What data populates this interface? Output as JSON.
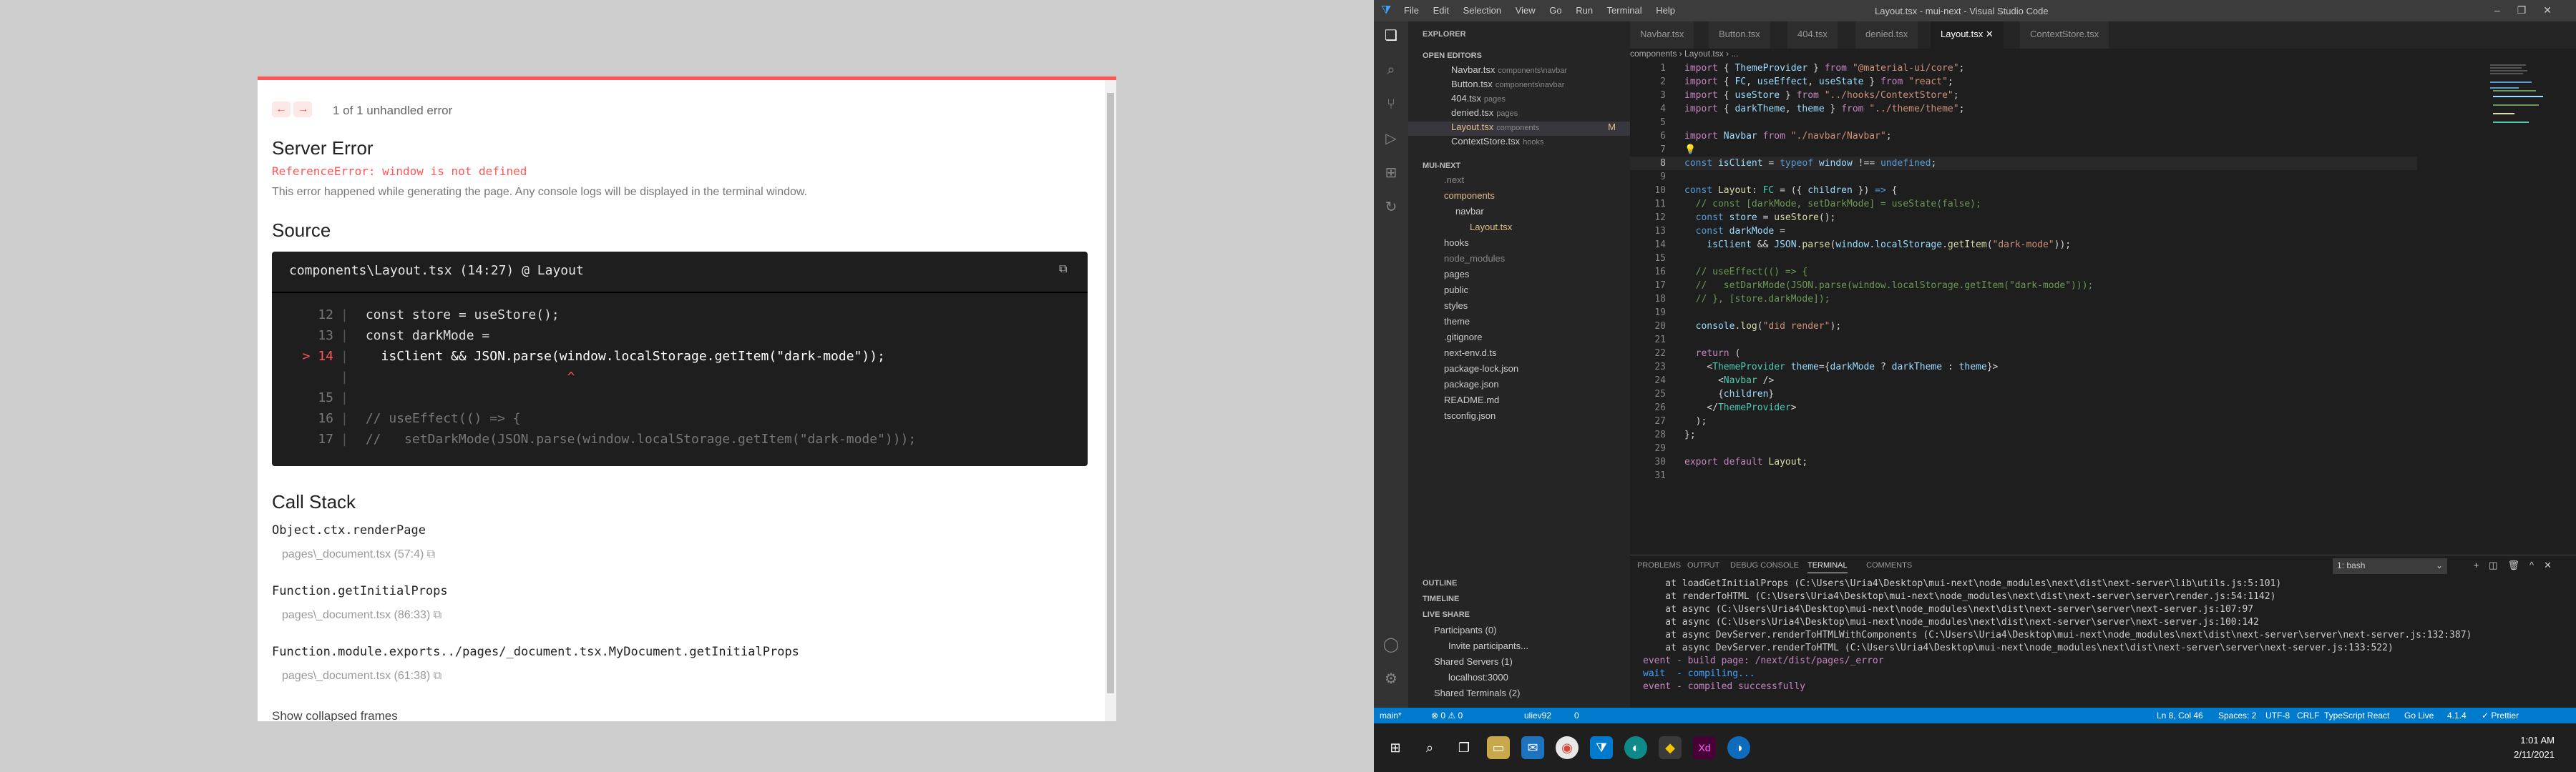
{
  "overlay": {
    "error_count": "1 of 1 unhandled error",
    "title": "Server Error",
    "reference_error": "ReferenceError: window is not defined",
    "description": "This error happened while generating the page. Any console logs will be displayed in the terminal window.",
    "source_heading": "Source",
    "code_file": "components\\Layout.tsx (14:27) @ Layout",
    "code_lines": [
      {
        "ln": "12",
        "text": "const store = useStore();"
      },
      {
        "ln": "13",
        "text": "const darkMode ="
      },
      {
        "ln": "> 14",
        "text": "  isClient && JSON.parse(window.localStorage.getItem(\"dark-mode\"));"
      },
      {
        "ln": "",
        "text": "                          ^"
      },
      {
        "ln": "15",
        "text": ""
      },
      {
        "ln": "16",
        "text": "// useEffect(() => {"
      },
      {
        "ln": "17",
        "text": "//   setDarkMode(JSON.parse(window.localStorage.getItem(\"dark-mode\")));"
      }
    ],
    "callstack_heading": "Call Stack",
    "callstack": [
      {
        "fn": "Object.ctx.renderPage",
        "loc": "pages\\_document.tsx (57:4)"
      },
      {
        "fn": "Function.getInitialProps",
        "loc": "pages\\_document.tsx (86:33)"
      },
      {
        "fn": "Function.module.exports../pages/_document.tsx.MyDocument.getInitialProps",
        "loc": "pages\\_document.tsx (61:38)"
      }
    ],
    "show_collapsed": "Show collapsed frames"
  },
  "vscode": {
    "title": "Layout.tsx - mui-next - Visual Studio Code",
    "menu": [
      "File",
      "Edit",
      "Selection",
      "View",
      "Go",
      "Run",
      "Terminal",
      "Help"
    ],
    "sidebar": {
      "explorer": "EXPLORER",
      "open_editors": "OPEN EDITORS",
      "open_files": [
        {
          "name": "Navbar.tsx",
          "dir": "components\\navbar"
        },
        {
          "name": "Button.tsx",
          "dir": "components\\navbar"
        },
        {
          "name": "404.tsx",
          "dir": "pages"
        },
        {
          "name": "denied.tsx",
          "dir": "pages"
        },
        {
          "name": "Layout.tsx",
          "dir": "components",
          "badge": "M"
        },
        {
          "name": "ContextStore.tsx",
          "dir": "hooks"
        }
      ],
      "project": "MUI-NEXT",
      "tree": [
        ".next",
        "components",
        "navbar",
        "Layout.tsx",
        "hooks",
        "node_modules",
        "pages",
        "public",
        "styles",
        "theme",
        ".gitignore",
        "next-env.d.ts",
        "package-lock.json",
        "package.json",
        "README.md",
        "tsconfig.json"
      ],
      "outline": "OUTLINE",
      "timeline": "TIMELINE",
      "live_share": "LIVE SHARE",
      "participants": "Participants (0)",
      "invite": "Invite participants...",
      "shared_servers": "Shared Servers (1)",
      "localhost": "localhost:3000",
      "shared_terminals": "Shared Terminals (2)"
    },
    "tabs": [
      "Navbar.tsx",
      "Button.tsx",
      "404.tsx",
      "denied.tsx",
      "Layout.tsx",
      "ContextStore.tsx"
    ],
    "breadcrumb": "components › Layout.tsx › ...",
    "panel_tabs": [
      "PROBLEMS",
      "OUTPUT",
      "DEBUG CONSOLE",
      "TERMINAL",
      "COMMENTS"
    ],
    "terminal_select": "1: bash",
    "terminal_lines": [
      "    at loadGetInitialProps (C:\\Users\\Uria4\\Desktop\\mui-next\\node_modules\\next\\dist\\next-server\\lib\\utils.js:5:101)",
      "    at renderToHTML (C:\\Users\\Uria4\\Desktop\\mui-next\\node_modules\\next\\dist\\next-server\\server\\render.js:54:1142)",
      "    at async (C:\\Users\\Uria4\\Desktop\\mui-next\\node_modules\\next\\dist\\next-server\\server\\next-server.js:107:97",
      "    at async (C:\\Users\\Uria4\\Desktop\\mui-next\\node_modules\\next\\dist\\next-server\\server\\next-server.js:100:142",
      "    at async DevServer.renderToHTMLWithComponents (C:\\Users\\Uria4\\Desktop\\mui-next\\node_modules\\next\\dist\\next-server\\server\\next-server.js:132:387)",
      "    at async DevServer.renderToHTML (C:\\Users\\Uria4\\Desktop\\mui-next\\node_modules\\next\\dist\\next-server\\server\\next-server.js:133:522)",
      "event - build page: /next/dist/pages/_error",
      "wait  - compiling...",
      "event - compiled successfully"
    ],
    "status": {
      "branch": "main*",
      "problems": "⊗ 0 ⚠ 0",
      "user": "uliev92",
      "ports": "0",
      "position": "Ln 8, Col 46",
      "spaces": "Spaces: 2",
      "encoding": "UTF-8",
      "eol": "CRLF",
      "language": "TypeScript React",
      "golive": "Go Live",
      "version": "4.1.4",
      "prettier": "✓ Prettier"
    }
  },
  "taskbar": {
    "time": "1:01 AM",
    "date": "2/11/2021"
  }
}
